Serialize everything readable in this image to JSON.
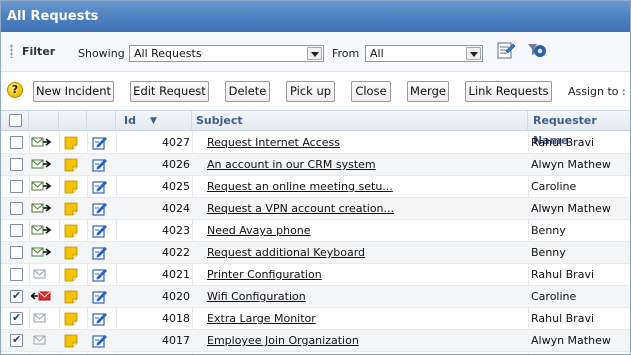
{
  "header": {
    "title": "All Requests"
  },
  "filter": {
    "label": "Filter",
    "showing_label": "Showing",
    "showing_value": "All Requests",
    "from_label": "From",
    "from_value": "All"
  },
  "toolbar": {
    "help_icon": "?",
    "buttons": [
      "New Incident",
      "Edit Request",
      "Delete",
      "Pick up",
      "Close",
      "Merge",
      "Link Requests"
    ],
    "assign_label": "Assign to :"
  },
  "table": {
    "columns": {
      "id": "Id",
      "subject": "Subject",
      "requester": "Requester Name"
    },
    "rows": [
      {
        "checked": false,
        "id": "4027",
        "subject": "Request Internet Access",
        "requester": "Rahul Bravi",
        "mail": "fwd"
      },
      {
        "checked": false,
        "id": "4026",
        "subject": "An account in our CRM system",
        "requester": "Alwyn Mathew",
        "mail": "fwd"
      },
      {
        "checked": false,
        "id": "4025",
        "subject": "Request an online meeting setu...",
        "requester": "Caroline",
        "mail": "fwd"
      },
      {
        "checked": false,
        "id": "4024",
        "subject": "Request a VPN account creation...",
        "requester": "Alwyn Mathew",
        "mail": "fwd"
      },
      {
        "checked": false,
        "id": "4023",
        "subject": "Need Avaya phone",
        "requester": "Benny",
        "mail": "fwd"
      },
      {
        "checked": false,
        "id": "4022",
        "subject": "Request additional Keyboard",
        "requester": "Benny",
        "mail": "fwd"
      },
      {
        "checked": false,
        "id": "4021",
        "subject": "Printer Configuration",
        "requester": "Rahul Bravi",
        "mail": "plain"
      },
      {
        "checked": true,
        "id": "4020",
        "subject": "Wifi Configuration",
        "requester": "Caroline",
        "mail": "red"
      },
      {
        "checked": true,
        "id": "4018",
        "subject": "Extra Large Monitor",
        "requester": "Rahul Bravi",
        "mail": "plain"
      },
      {
        "checked": true,
        "id": "4017",
        "subject": "Employee Join Organization",
        "requester": "Alwyn Mathew",
        "mail": "plain"
      }
    ]
  },
  "colors": {
    "title_bar": "#4c7fbf",
    "header_text": "#3f5f8c",
    "note": "#f5c400",
    "edit": "#2b63c4"
  }
}
